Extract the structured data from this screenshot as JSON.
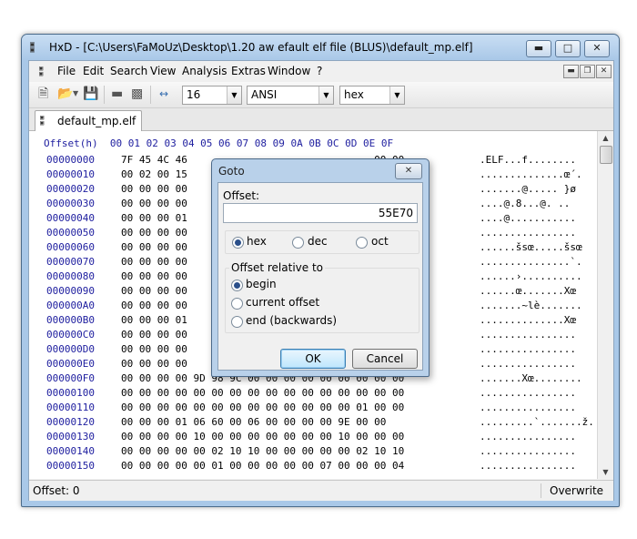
{
  "window": {
    "title": "HxD - [C:\\Users\\FaMoUz\\Desktop\\1.20 aw efault elf file (BLUS)\\default_mp.elf]",
    "min_icon": "minimize-icon",
    "max_icon": "maximize-icon",
    "close_icon": "close-icon"
  },
  "menu": {
    "items": [
      "File",
      "Edit",
      "Search",
      "View",
      "Analysis",
      "Extras",
      "Window",
      "?"
    ]
  },
  "toolbar": {
    "bytes_per_row": "16",
    "charset": "ANSI",
    "offset_base": "hex"
  },
  "tab": {
    "label": "default_mp.elf"
  },
  "hex": {
    "header": "Offset(h)  00 01 02 03 04 05 06 07 08 09 0A 0B 0C 0D 0E 0F",
    "rows": [
      {
        "addr": "00000000",
        "bytes": "7F 45 4C 46                               00 00",
        "text": ".ELF...f........"
      },
      {
        "addr": "00000010",
        "bytes": "00 02 00 15                               4 18",
        "text": "..............œ´."
      },
      {
        "addr": "00000020",
        "bytes": "00 00 00 00                               D F8",
        "text": ".......@..... }ø"
      },
      {
        "addr": "00000030",
        "bytes": "00 00 00 00                               0 1F",
        "text": "....@.8...@. .."
      },
      {
        "addr": "00000040",
        "bytes": "00 00 00 01                               00",
        "text": "....@..........."
      },
      {
        "addr": "00000050",
        "bytes": "00 00 00 00                               00 00",
        "text": "................"
      },
      {
        "addr": "00000060",
        "bytes": "00 00 00 00                               3 9C",
        "text": "......šsœ.....šsœ"
      },
      {
        "addr": "00000070",
        "bytes": "00 00 00 00                               00 06",
        "text": "...............`."
      },
      {
        "addr": "00000080",
        "bytes": "00 00 00 00                               00 00",
        "text": "......›.........."
      },
      {
        "addr": "00000090",
        "bytes": "00 00 00 00                               8 9C",
        "text": "......œ.......Xœ"
      },
      {
        "addr": "000000A0",
        "bytes": "00 00 00 00                               00 00",
        "text": ".......~lè......."
      },
      {
        "addr": "000000B0",
        "bytes": "00 00 00 01                               8 9C",
        "text": "..............Xœ"
      },
      {
        "addr": "000000C0",
        "bytes": "00 00 00 00                               00 00",
        "text": "................"
      },
      {
        "addr": "000000D0",
        "bytes": "00 00 00 00                               00 00",
        "text": "................"
      },
      {
        "addr": "000000E0",
        "bytes": "00 00 00 00                               00 06",
        "text": "................"
      },
      {
        "addr": "000000F0",
        "bytes": "00 00 00 00 9D 98 9C 00 00 00 00 00 00 00 00 00",
        "text": ".......Xœ........"
      },
      {
        "addr": "00000100",
        "bytes": "00 00 00 00 00 00 00 00 00 00 00 00 00 00 00 00",
        "text": "................"
      },
      {
        "addr": "00000110",
        "bytes": "00 00 00 00 00 00 00 00 00 00 00 00 00 01 00 00",
        "text": "................"
      },
      {
        "addr": "00000120",
        "bytes": "00 00 00 01 06 60 00 06 00 00 00 00 9E 00 00",
        "text": ".........`.......ž."
      },
      {
        "addr": "00000130",
        "bytes": "00 00 00 00 10 00 00 00 00 00 00 00 10 00 00 00",
        "text": "................"
      },
      {
        "addr": "00000140",
        "bytes": "00 00 00 00 00 02 10 10 00 00 00 00 00 02 10 10",
        "text": "................"
      },
      {
        "addr": "00000150",
        "bytes": "00 00 00 00 00 01 00 00 00 00 00 07 00 00 00 04",
        "text": "................"
      }
    ]
  },
  "status": {
    "offset": "Offset: 0",
    "mode": "Overwrite"
  },
  "dialog": {
    "title": "Goto",
    "offset_label": "Offset:",
    "offset_value": "55E70",
    "formats": [
      "hex",
      "dec",
      "oct"
    ],
    "selected_format": "hex",
    "relative_label": "Offset relative to",
    "relative_options": [
      "begin",
      "current offset",
      "end (backwards)"
    ],
    "selected_relative": "begin",
    "ok": "OK",
    "cancel": "Cancel"
  }
}
